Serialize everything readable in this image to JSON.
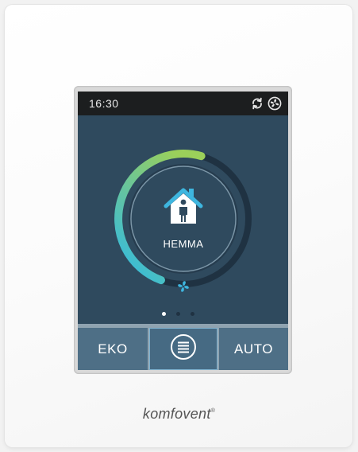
{
  "status_bar": {
    "time": "16:30",
    "icons": [
      "sync-icon",
      "fan-status-icon"
    ]
  },
  "dial": {
    "mode_label": "HEMMA",
    "mode_icon": "home-person-icon",
    "fan_icon": "fan-icon",
    "level": 0.55,
    "colors": {
      "arc_start": "#2db9e8",
      "arc_end": "#9bd05a",
      "track": "#1f3242",
      "knob": "#2f4a5e"
    }
  },
  "pager": {
    "count": 3,
    "active": 0
  },
  "buttons": {
    "eko_label": "EKO",
    "menu_icon": "menu-icon",
    "auto_label": "AUTO"
  },
  "brand": {
    "name": "komfovent",
    "mark": "®"
  }
}
